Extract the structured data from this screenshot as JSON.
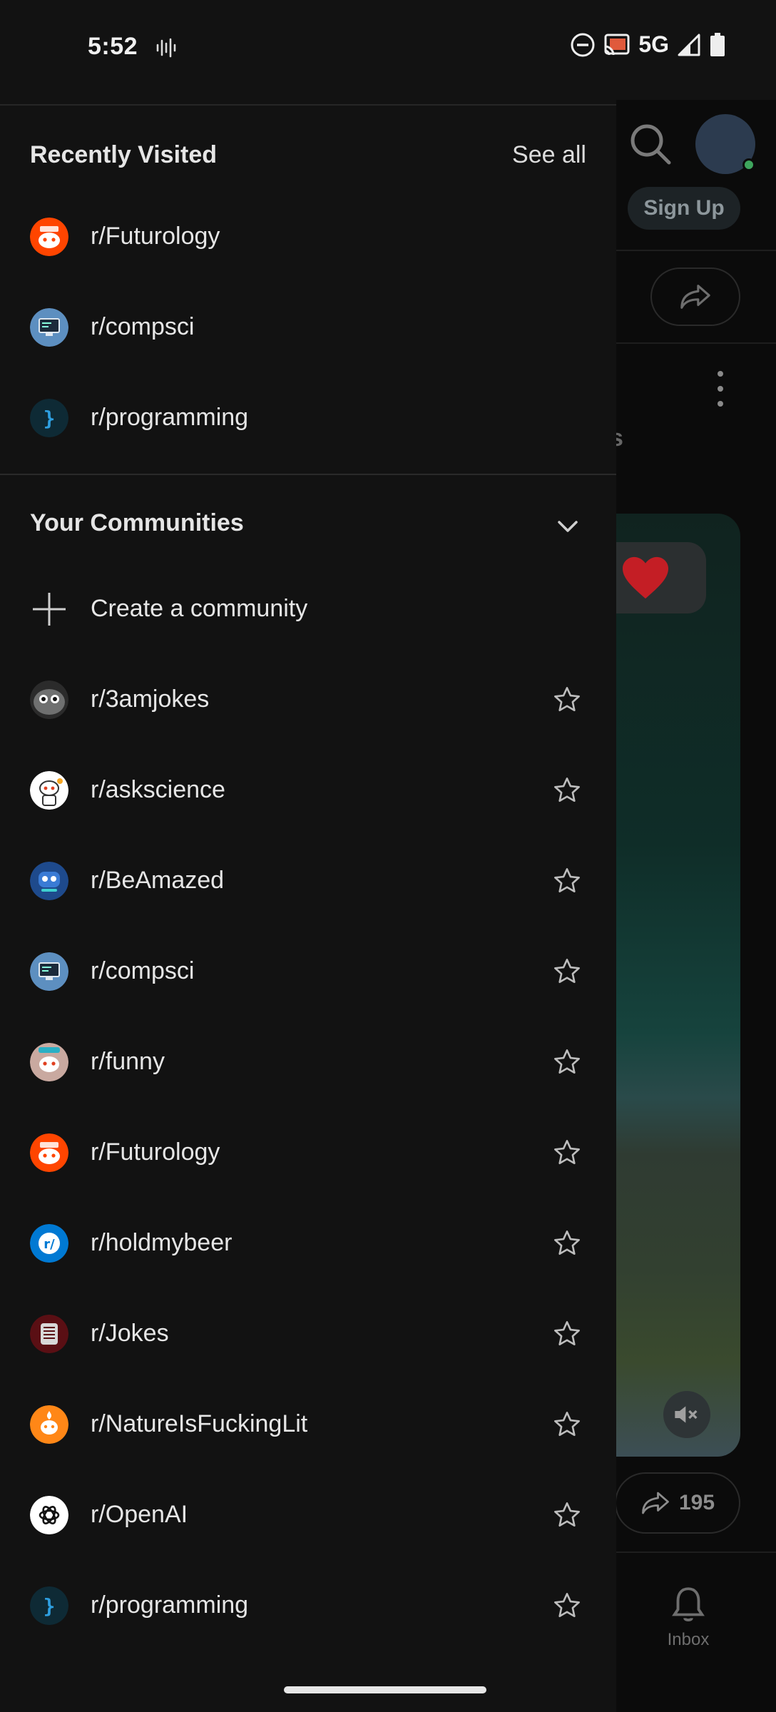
{
  "status_bar": {
    "time": "5:52",
    "network": "5G"
  },
  "background": {
    "sign_up": "Sign Up",
    "share_count": "195",
    "inbox_label": "Inbox",
    "partial_text": "s"
  },
  "drawer": {
    "recently_visited": {
      "title": "Recently Visited",
      "see_all": "See all",
      "items": [
        {
          "label": "r/Futurology",
          "icon": "futurology-avatar",
          "color": "#ff4500"
        },
        {
          "label": "r/compsci",
          "icon": "compsci-avatar",
          "color": "#5d8fc0"
        },
        {
          "label": "r/programming",
          "icon": "programming-avatar",
          "color": "#0e2a35"
        }
      ]
    },
    "communities": {
      "title": "Your Communities",
      "create_label": "Create a community",
      "items": [
        {
          "label": "r/3amjokes",
          "icon": "3amjokes-avatar",
          "color": "#6f7070"
        },
        {
          "label": "r/askscience",
          "icon": "askscience-avatar",
          "color": "#ffffff"
        },
        {
          "label": "r/BeAmazed",
          "icon": "beamazed-avatar",
          "color": "#1e4a8c"
        },
        {
          "label": "r/compsci",
          "icon": "compsci-avatar",
          "color": "#5d8fc0"
        },
        {
          "label": "r/funny",
          "icon": "funny-avatar",
          "color": "#c9a9a0"
        },
        {
          "label": "r/Futurology",
          "icon": "futurology-avatar",
          "color": "#ff4500"
        },
        {
          "label": "r/holdmybeer",
          "icon": "holdmybeer-avatar",
          "color": "#0079d3"
        },
        {
          "label": "r/Jokes",
          "icon": "jokes-avatar",
          "color": "#5a0f14"
        },
        {
          "label": "r/NatureIsFuckingLit",
          "icon": "natureisfuckinglit-avatar",
          "color": "#ff8717"
        },
        {
          "label": "r/OpenAI",
          "icon": "openai-avatar",
          "color": "#ffffff"
        },
        {
          "label": "r/programming",
          "icon": "programming-avatar",
          "color": "#0e2a35"
        }
      ]
    }
  }
}
